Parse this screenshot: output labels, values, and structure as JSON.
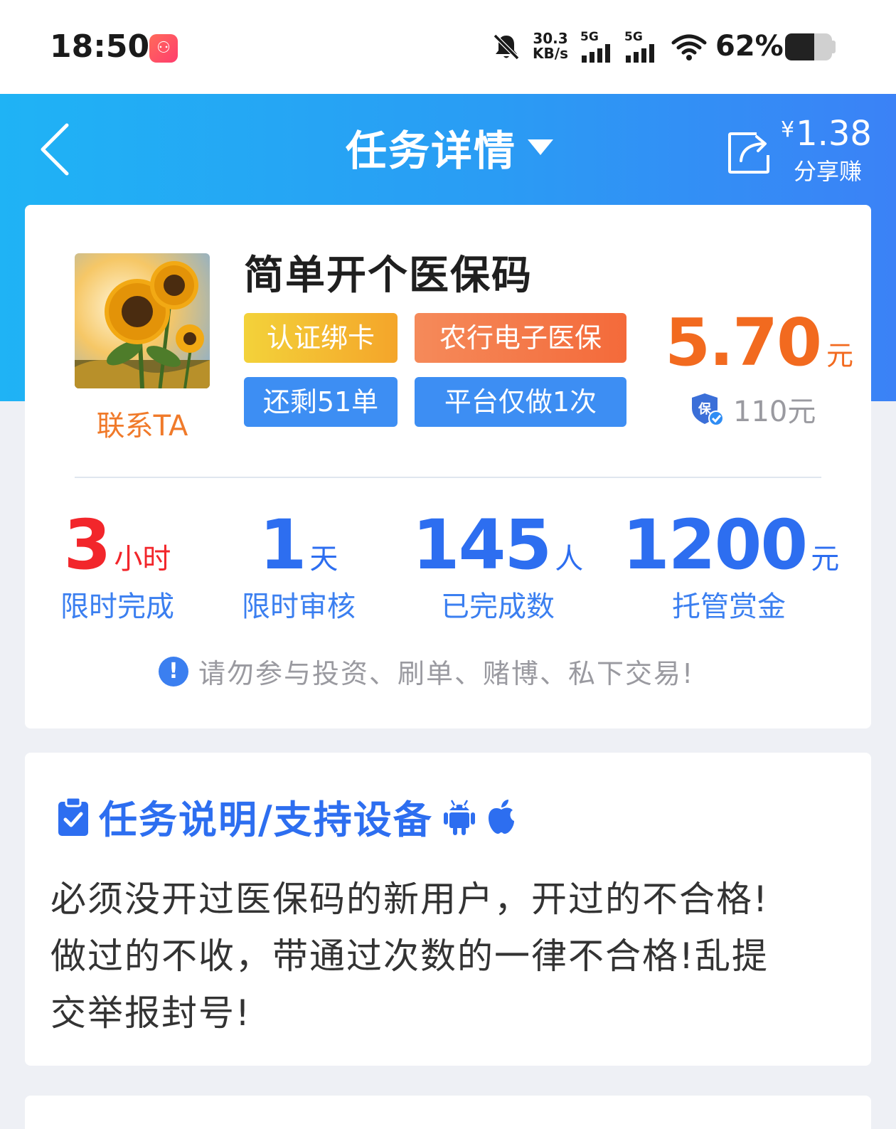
{
  "status_bar": {
    "time": "18:50",
    "app_icon": "kuaishou-app-icon",
    "net_speed_value": "30.3",
    "net_speed_unit": "KB/s",
    "signal_1_label": "5G",
    "signal_2_label": "5G",
    "battery_percent": "62%",
    "battery_level": 0.62
  },
  "header": {
    "title": "任务详情",
    "share_currency": "¥",
    "share_amount": "1.38",
    "share_label": "分享赚",
    "colors": {
      "gradient_start": "#1fb3f5",
      "gradient_end": "#3b82f6"
    }
  },
  "task": {
    "contact_label": "联系TA",
    "title": "简单开个医保码",
    "tags": [
      "认证绑卡",
      "农行电子医保",
      "还剩51单",
      "平台仅做1次"
    ],
    "price": "5.70",
    "price_unit": "元",
    "deposit": "110元",
    "stats": [
      {
        "value": "3",
        "unit": "小时",
        "label": "限时完成"
      },
      {
        "value": "1",
        "unit": "天",
        "label": "限时审核"
      },
      {
        "value": "145",
        "unit": "人",
        "label": "已完成数"
      },
      {
        "value": "1200",
        "unit": "元",
        "label": "托管赏金"
      }
    ],
    "warning_icon": "!",
    "warning": "请勿参与投资、刷单、赌博、私下交易!"
  },
  "description": {
    "title": "任务说明/支持设备",
    "lines": [
      "必须没开过医保码的新用户，开过的不合格!",
      "做过的不收，带通过次数的一律不合格!乱提",
      "交举报封号!"
    ]
  }
}
